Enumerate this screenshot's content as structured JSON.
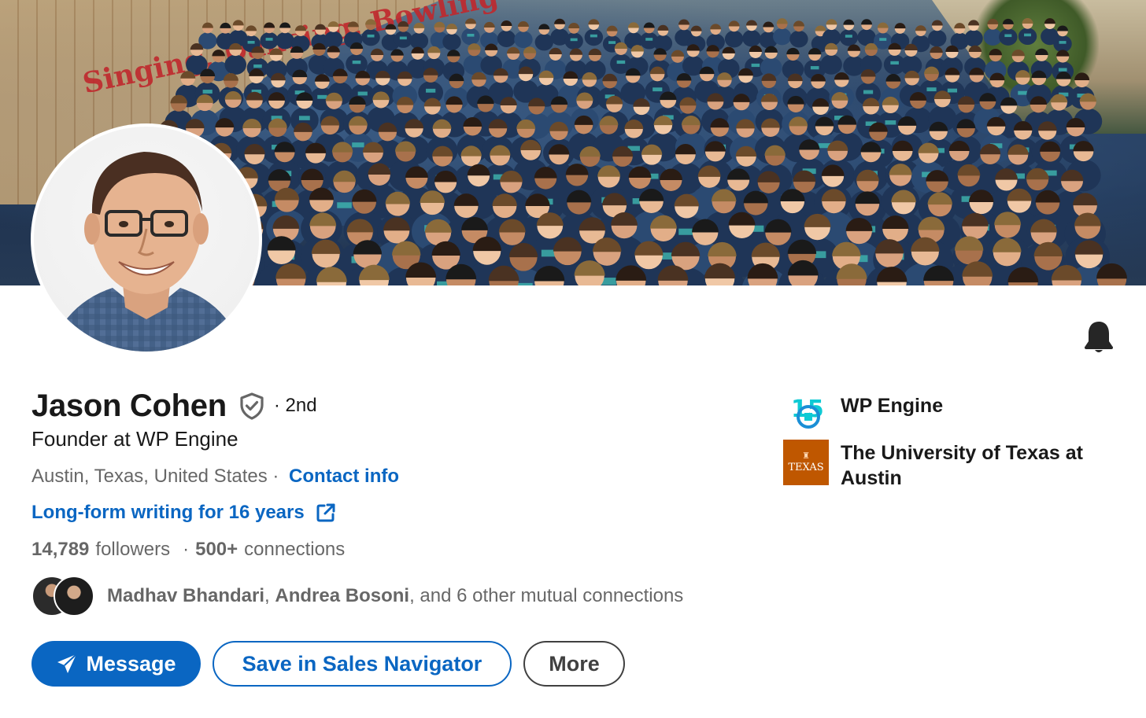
{
  "profile": {
    "name": "Jason Cohen",
    "degree": "· 2nd",
    "headline": "Founder at WP Engine",
    "location": "Austin, Texas, United States",
    "location_sep": " · ",
    "contact_info": "Contact info",
    "website_label": "Long-form writing for 16 years",
    "followers_count": "14,789",
    "followers_label": "followers",
    "connections_sep": "·",
    "connections_count": "500+",
    "connections_label": "connections",
    "mutual": {
      "name1": "Madhav Bhandari",
      "sep1": ",",
      "name2": "Andrea Bosoni",
      "rest": ", and 6 other mutual connections"
    },
    "icons": {
      "verified": "shield-check-icon",
      "bell": "bell-icon",
      "external_link": "external-link-icon",
      "send": "send-icon"
    }
  },
  "cover": {
    "sign_text": "Singing, Dancing, Bowling"
  },
  "actions": {
    "message": "Message",
    "save_sales_navigator": "Save in Sales Navigator",
    "more": "More"
  },
  "experience": [
    {
      "name": "WP Engine",
      "logo_text": "15"
    },
    {
      "name": "The University of Texas at Austin",
      "logo_text": "TEXAS"
    }
  ],
  "colors": {
    "accent": "#0a66c2",
    "ut_orange": "#bf5700",
    "wp_blue": "#0ecad4"
  }
}
